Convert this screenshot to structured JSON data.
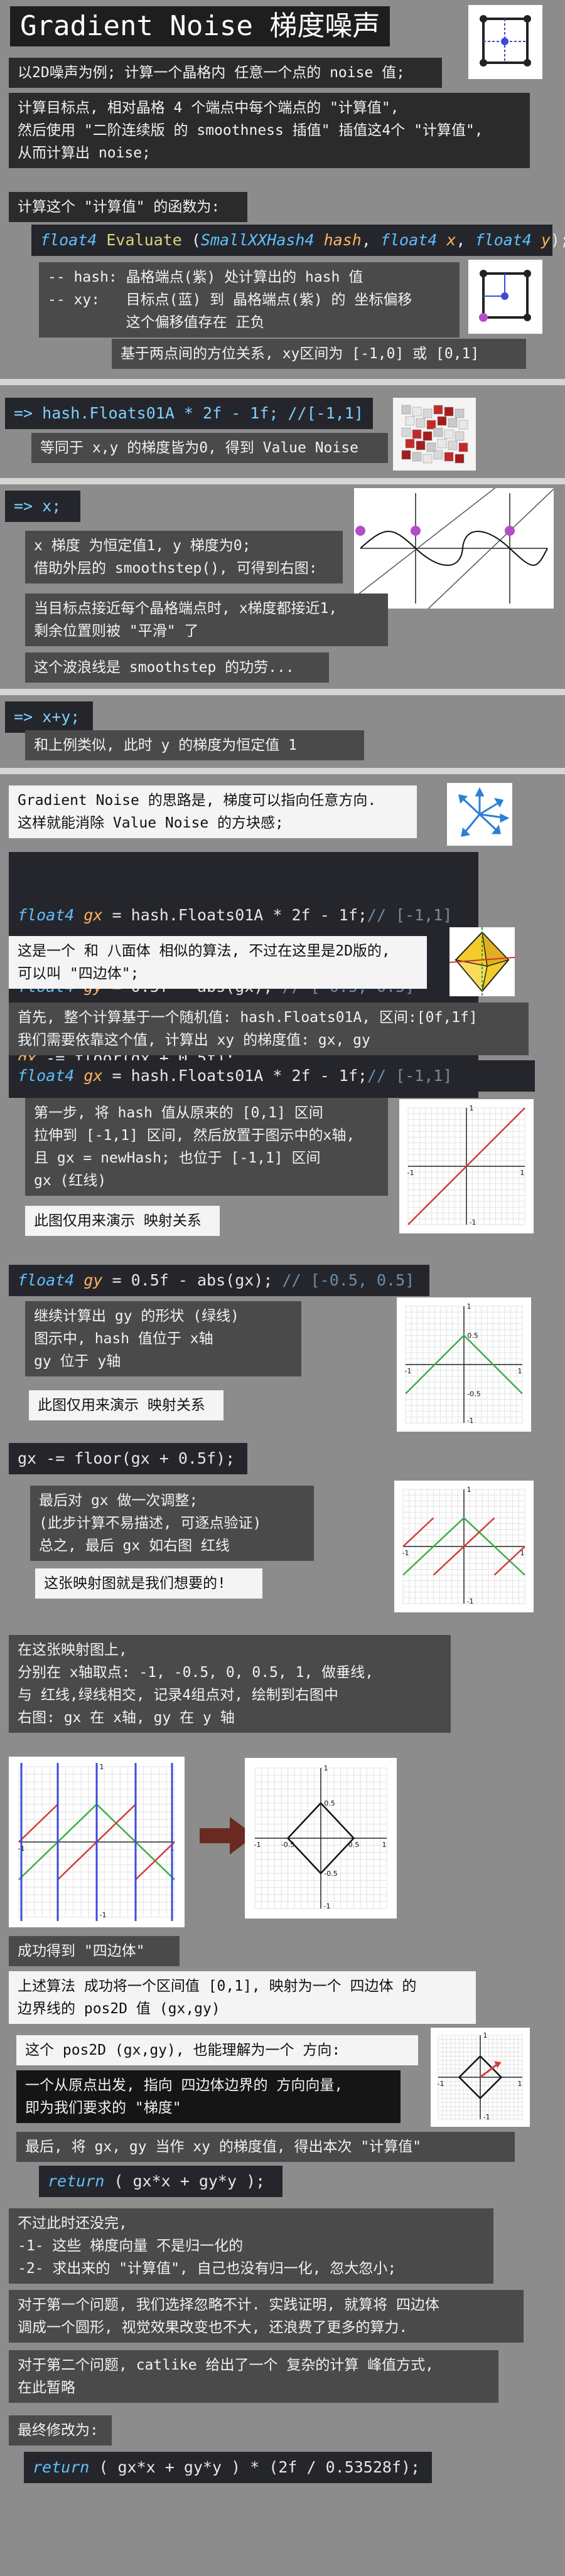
{
  "title": "Gradient Noise 梯度噪声",
  "intro": "以2D噪声为例; 计算一个晶格内 任意一个点的 noise 值;",
  "calc_target": [
    "计算目标点, 相对晶格 4 个端点中每个端点的 \"计算值\",",
    "然后使用 \"二阶连续版 的 smoothness 插值\" 插值这4个 \"计算值\",",
    "从而计算出 noise;"
  ],
  "func_label": "计算这个 \"计算值\" 的函数为:",
  "func_sig": {
    "ty1": "float4",
    "name": "Evaluate",
    "p1ty": "SmallXXHash4",
    "p1": "hash",
    "p2ty": "float4",
    "p2": "x",
    "p3ty": "float4",
    "p3": "y"
  },
  "func_notes": [
    "-- hash: 晶格端点(紫) 处计算出的 hash 值",
    "-- xy:   目标点(蓝) 到 晶格端点(紫) 的 坐标偏移",
    "         这个偏移值存在 正负"
  ],
  "func_range": "基于两点间的方位关系, xy区间为 [-1,0] 或 [0,1]",
  "sec1_code": "=> hash.Floats01A * 2f - 1f; //[-1,1]",
  "sec1_note": "等同于 x,y 的梯度皆为0, 得到 Value Noise",
  "sec2_code": "=> x;",
  "sec2_lines": [
    "x 梯度 为恒定值1, y 梯度为0;",
    "借助外层的 smoothstep(), 可得到右图:"
  ],
  "sec2_more": [
    "当目标点接近每个晶格端点时, x梯度都接近1,",
    "剩余位置则被 \"平滑\" 了"
  ],
  "sec2_wave": "这个波浪线是 smoothstep 的功劳...",
  "sec3_code": "=> x+y;",
  "sec3_note": "和上例类似, 此时 y 的梯度为恒定值 1",
  "gn_idea": [
    "Gradient Noise 的思路是, 梯度可以指向任意方向.",
    "这样就能消除 Value Noise 的方块感;"
  ],
  "code_block": [
    {
      "v": "gx",
      "expr": " = hash.Floats01A * 2f - 1f;",
      "cm": "// [-1,1]"
    },
    {
      "v": "gy",
      "expr": " = 0.5f - abs(gx);",
      "cm": " // [-0.5, 0.5]"
    },
    {
      "v": "gx",
      "expr": " -= floor(gx + 0.5f);",
      "cm": ""
    }
  ],
  "kw_float4": "float4",
  "octa_note": [
    "这是一个 和 八面体 相似的算法, 不过在这里是2D版的,",
    "可以叫 \"四边体\";"
  ],
  "first_note": [
    "首先, 整个计算基于一个随机值: hash.Floats01A, 区间:[0f,1f]",
    "我们需要依靠这个值, 计算出 xy 的梯度值: gx, gy"
  ],
  "step1_code": {
    "v": "gx",
    "expr": " = hash.Floats01A * 2f - 1f;",
    "cm": "// [-1,1]"
  },
  "step1_text": [
    "第一步, 将 hash 值从原来的 [0,1] 区间",
    "拉伸到 [-1,1] 区间, 然后放置于图示中的x轴,",
    "且 gx = newHash; 也位于 [-1,1] 区间",
    "gx (红线)"
  ],
  "step1_demo": "此图仅用来演示 映射关系",
  "step2_code": {
    "v": "gy",
    "expr": " = 0.5f - abs(gx);",
    "cm": " // [-0.5, 0.5]"
  },
  "step2_text": [
    "继续计算出 gy 的形状 (绿线)",
    "图示中, hash 值位于 x轴",
    "gy 位于 y轴"
  ],
  "step2_demo": "此图仅用来演示 映射关系",
  "step3_code": "gx -= floor(gx + 0.5f);",
  "step3_text": [
    "最后对 gx 做一次调整;",
    "(此步计算不易描述, 可逐点验证)",
    "总之, 最后 gx 如右图 红线"
  ],
  "step3_want": "这张映射图就是我们想要的!",
  "map_text": [
    "在这张映射图上,",
    "分别在 x轴取点: -1, -0.5, 0, 0.5, 1, 做垂线,",
    "与 红线,绿线相交, 记录4组点对, 绘制到右图中",
    "右图: gx 在 x轴, gy 在 y 轴"
  ],
  "got_quad": "成功得到 \"四边体\"",
  "summary": [
    "上述算法 成功将一个区间值 [0,1], 映射为一个 四边体 的",
    "边界线的 pos2D 值 (gx,gy)"
  ],
  "dir_note": "这个 pos2D (gx,gy), 也能理解为一个 方向:",
  "dir_dark": [
    "一个从原点出发, 指向 四边体边界的 方向向量,",
    "即为我们要求的 \"梯度\""
  ],
  "final_note": "最后, 将 gx, gy 当作 xy 的梯度值, 得出本次 \"计算值\"",
  "return1": {
    "kw": "return",
    "expr": " ( gx*x + gy*y );"
  },
  "issues": [
    "不过此时还没完,",
    "-1- 这些 梯度向量 不是归一化的",
    "-2- 求出来的 \"计算值\", 自己也没有归一化, 忽大忽小;"
  ],
  "issue1": [
    "对于第一个问题, 我们选择忽略不计. 实践证明, 就算将 四边体",
    "调成一个圆形, 视觉效果改变也不大, 还浪费了更多的算力."
  ],
  "issue2": [
    "对于第二个问题, catlike 给出了一个 复杂的计算 峰值方式,",
    "在此暂略"
  ],
  "final_mod": "最终修改为:",
  "return2": {
    "kw": "return",
    "expr": " ( gx*x + gy*y ) * (2f / 0.53528f);"
  },
  "axis": {
    "p1": "1",
    "m1": "-1",
    "p05": "0.5",
    "m05": "-0.5"
  },
  "colors": {
    "red": "#d23c3c",
    "green": "#3cae4a",
    "blue": "#3a4cd8",
    "purple": "#b54cc8",
    "arrow": "#6a2a22"
  }
}
